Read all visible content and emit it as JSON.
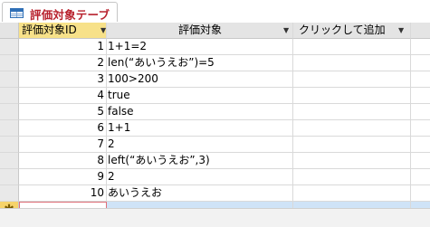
{
  "tab": {
    "title": "評価対象テーブル"
  },
  "columns": {
    "id": "評価対象ID",
    "target": "評価対象",
    "add": "クリックして追加"
  },
  "rows": [
    {
      "id": "1",
      "value": "1+1=2"
    },
    {
      "id": "2",
      "value": "len(“あいうえお”)=5"
    },
    {
      "id": "3",
      "value": "100>200"
    },
    {
      "id": "4",
      "value": "true"
    },
    {
      "id": "5",
      "value": "false"
    },
    {
      "id": "6",
      "value": "1+1"
    },
    {
      "id": "7",
      "value": "2"
    },
    {
      "id": "8",
      "value": "left(“あいうえお”,3)"
    },
    {
      "id": "9",
      "value": "2"
    },
    {
      "id": "10",
      "value": "あいうえお"
    }
  ],
  "new_row_marker": "✱",
  "colors": {
    "accent": "#b8222e",
    "header_selected": "#f7e189",
    "new_row_highlight": "#cfe3f7"
  },
  "icons": {
    "tab": "table-icon",
    "dropdown": "chevron-down-icon"
  }
}
